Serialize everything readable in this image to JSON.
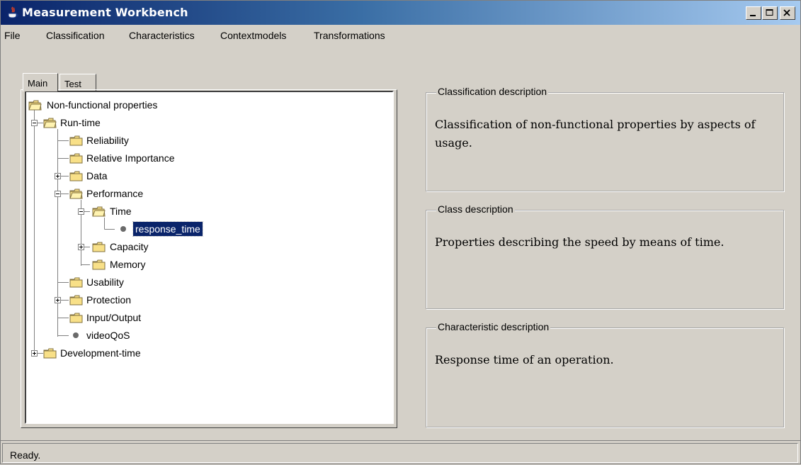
{
  "window": {
    "title": "Measurement Workbench",
    "colors": {
      "titlebar_start": "#0a246a",
      "titlebar_end": "#a6caf0",
      "face": "#d4d0c8",
      "selection": "#0a246a",
      "folder": "#f8e088"
    }
  },
  "menubar": {
    "items": [
      "File",
      "Classification",
      "Characteristics",
      "Contextmodels",
      "Transformations"
    ]
  },
  "tabs": [
    {
      "label": "Main",
      "selected": true
    },
    {
      "label": "Test",
      "selected": false
    }
  ],
  "tree": {
    "nodes": [
      {
        "label": "Non-functional properties",
        "icon": "open-folder-icon",
        "expander": "none"
      },
      {
        "label": "Run-time",
        "icon": "open-folder-icon",
        "expander": "expanded"
      },
      {
        "label": "Reliability",
        "icon": "folder-icon",
        "expander": "none"
      },
      {
        "label": "Relative Importance",
        "icon": "folder-icon",
        "expander": "none"
      },
      {
        "label": "Data",
        "icon": "folder-icon",
        "expander": "collapsed"
      },
      {
        "label": "Performance",
        "icon": "open-folder-icon",
        "expander": "expanded"
      },
      {
        "label": "Time",
        "icon": "open-folder-icon",
        "expander": "expanded"
      },
      {
        "label": "response_time",
        "icon": "leaf-bullet-icon",
        "expander": "none",
        "selected": true
      },
      {
        "label": "Capacity",
        "icon": "folder-icon",
        "expander": "collapsed"
      },
      {
        "label": "Memory",
        "icon": "folder-icon",
        "expander": "none"
      },
      {
        "label": "Usability",
        "icon": "folder-icon",
        "expander": "none"
      },
      {
        "label": "Protection",
        "icon": "folder-icon",
        "expander": "collapsed"
      },
      {
        "label": "Input/Output",
        "icon": "folder-icon",
        "expander": "none"
      },
      {
        "label": "videoQoS",
        "icon": "leaf-bullet-icon",
        "expander": "none"
      },
      {
        "label": "Development-time",
        "icon": "folder-icon",
        "expander": "collapsed"
      }
    ]
  },
  "panels": {
    "classification": {
      "title": "Classification description",
      "text": "Classification of non-functional properties by aspects of usage."
    },
    "class": {
      "title": "Class description",
      "text": "Properties describing the speed by means of time."
    },
    "characteristic": {
      "title": "Characteristic description",
      "text": "Response time of an operation."
    }
  },
  "status": {
    "text": "Ready."
  }
}
